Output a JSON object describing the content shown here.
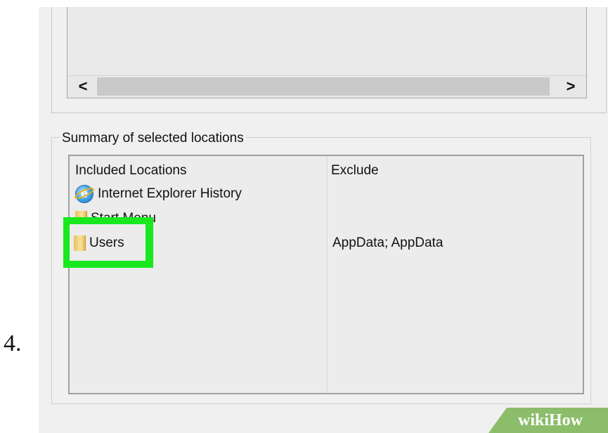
{
  "step": {
    "number": "4."
  },
  "upper_list": {
    "scroll_left_label": "<",
    "scroll_right_label": ">"
  },
  "summary": {
    "title": "Summary of selected locations",
    "columns": {
      "included": "Included Locations",
      "exclude": "Exclude"
    },
    "rows": [
      {
        "icon": "internet-explorer-icon",
        "label": "Internet Explorer History",
        "exclude": ""
      },
      {
        "icon": "folder-icon",
        "label": "Start Menu",
        "exclude": ""
      },
      {
        "icon": "folder-icon",
        "label": "Users",
        "exclude": "AppData; AppData"
      }
    ]
  },
  "highlight": {
    "color": "#19e81f"
  },
  "watermark": {
    "text": "wikiHow"
  }
}
